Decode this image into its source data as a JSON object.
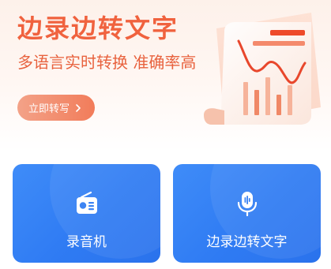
{
  "banner": {
    "title": "边录边转文字",
    "subtitle": "多语言实时转换 准确率高",
    "cta_label": "立即转写"
  },
  "cards": [
    {
      "label": "录音机",
      "icon": "radio-icon"
    },
    {
      "label": "边录边转文字",
      "icon": "microphone-icon"
    }
  ],
  "colors": {
    "accent_orange": "#f0623e",
    "card_blue": "#2f7bf3"
  }
}
